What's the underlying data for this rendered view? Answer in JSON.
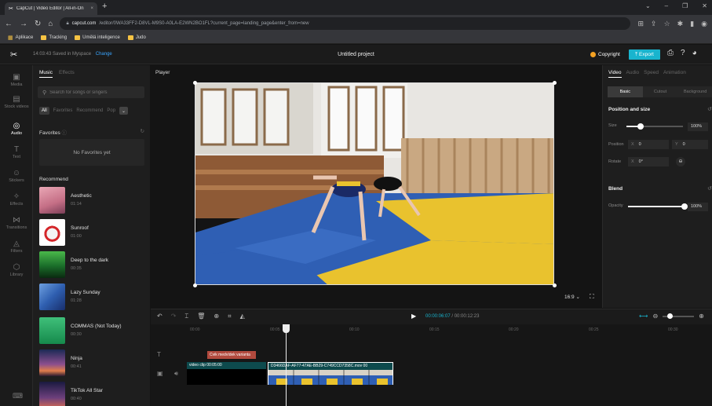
{
  "browser": {
    "tab_title": "CapCut | Video Editor | All-in-On",
    "tab_close": "×",
    "new_tab": "+",
    "url_host": "capcut.com",
    "url_path": "/editor/0WA33FF2-D8VL-M9S0-A0LA-E2WN2BO1FL?current_page=landing_page&enter_from=new",
    "bookmarks": [
      "Aplikace",
      "Tracking",
      "Umělá inteligence",
      "Judo"
    ]
  },
  "app": {
    "logo": "✂",
    "saved_text": "14:03:43  Saved in Myspace",
    "change_link": "Change",
    "project_title": "Untitled project",
    "copyright_label": "Copyright",
    "export_label": "Export"
  },
  "rail": [
    {
      "label": "Media",
      "icon": "media-icon",
      "glyph": "▣"
    },
    {
      "label": "Stock videos",
      "icon": "stock-videos-icon",
      "glyph": "▤"
    },
    {
      "label": "Audio",
      "icon": "audio-icon",
      "glyph": "◎"
    },
    {
      "label": "Text",
      "icon": "text-icon",
      "glyph": "T"
    },
    {
      "label": "Stickers",
      "icon": "stickers-icon",
      "glyph": "☺"
    },
    {
      "label": "Effects",
      "icon": "effects-icon",
      "glyph": "✧"
    },
    {
      "label": "Transitions",
      "icon": "transitions-icon",
      "glyph": "⋈"
    },
    {
      "label": "Filters",
      "icon": "filters-icon",
      "glyph": "◬"
    },
    {
      "label": "Library",
      "icon": "library-icon",
      "glyph": "⬡"
    }
  ],
  "music": {
    "tabs": [
      "Music",
      "Effects"
    ],
    "search_placeholder": "Search for songs or singers",
    "filters": [
      "All",
      "Favorites",
      "Recommend",
      "Pop"
    ],
    "more": "⌄",
    "favorites_title": "Favorites",
    "favorites_empty": "No Favorites yet",
    "recommend_title": "Recommend",
    "songs": [
      {
        "name": "Aesthetic",
        "duration": "01:14"
      },
      {
        "name": "Sunroof",
        "duration": "01:00"
      },
      {
        "name": "Deep to the dark",
        "duration": "00:35"
      },
      {
        "name": "Lazy Sunday",
        "duration": "01:28"
      },
      {
        "name": "COMMAS (Not Today)",
        "duration": "00:30"
      },
      {
        "name": "Ninja",
        "duration": "00:41"
      },
      {
        "name": "TikTok All Star",
        "duration": "00:40"
      }
    ]
  },
  "player": {
    "label": "Player",
    "aspect_ratio": "16:9",
    "aspect_chevron": "⌄"
  },
  "props": {
    "tabs": [
      "Video",
      "Audio",
      "Speed",
      "Animation"
    ],
    "subtabs": [
      "Basic",
      "Cutout",
      "Background"
    ],
    "position_title": "Position and size",
    "size_label": "Size",
    "size_value": "100%",
    "size_fraction": 0.25,
    "position_label": "Position",
    "pos_x_axis": "X",
    "pos_x": "0",
    "pos_y_axis": "Y",
    "pos_y": "0",
    "rotate_label": "Rotate",
    "rot_axis": "X",
    "rotate_value": "0°",
    "blend_title": "Blend",
    "opacity_label": "Opacity",
    "opacity_value": "100%",
    "opacity_fraction": 1.0
  },
  "timeline": {
    "timecode_current": "00:00:06:07",
    "timecode_sep": " / ",
    "timecode_total": "00:00:12:23",
    "ruler": [
      "00:00",
      "00:05",
      "00:10",
      "00:15",
      "00:20",
      "00:25",
      "00:30"
    ],
    "text_clip": "Cvik medvídek varianta",
    "clip1_label": "video clip   00:05:00",
    "clip2_label": "D3466DAF-AF77-47AE-BB29-C749CCD7358C.mov   00"
  }
}
